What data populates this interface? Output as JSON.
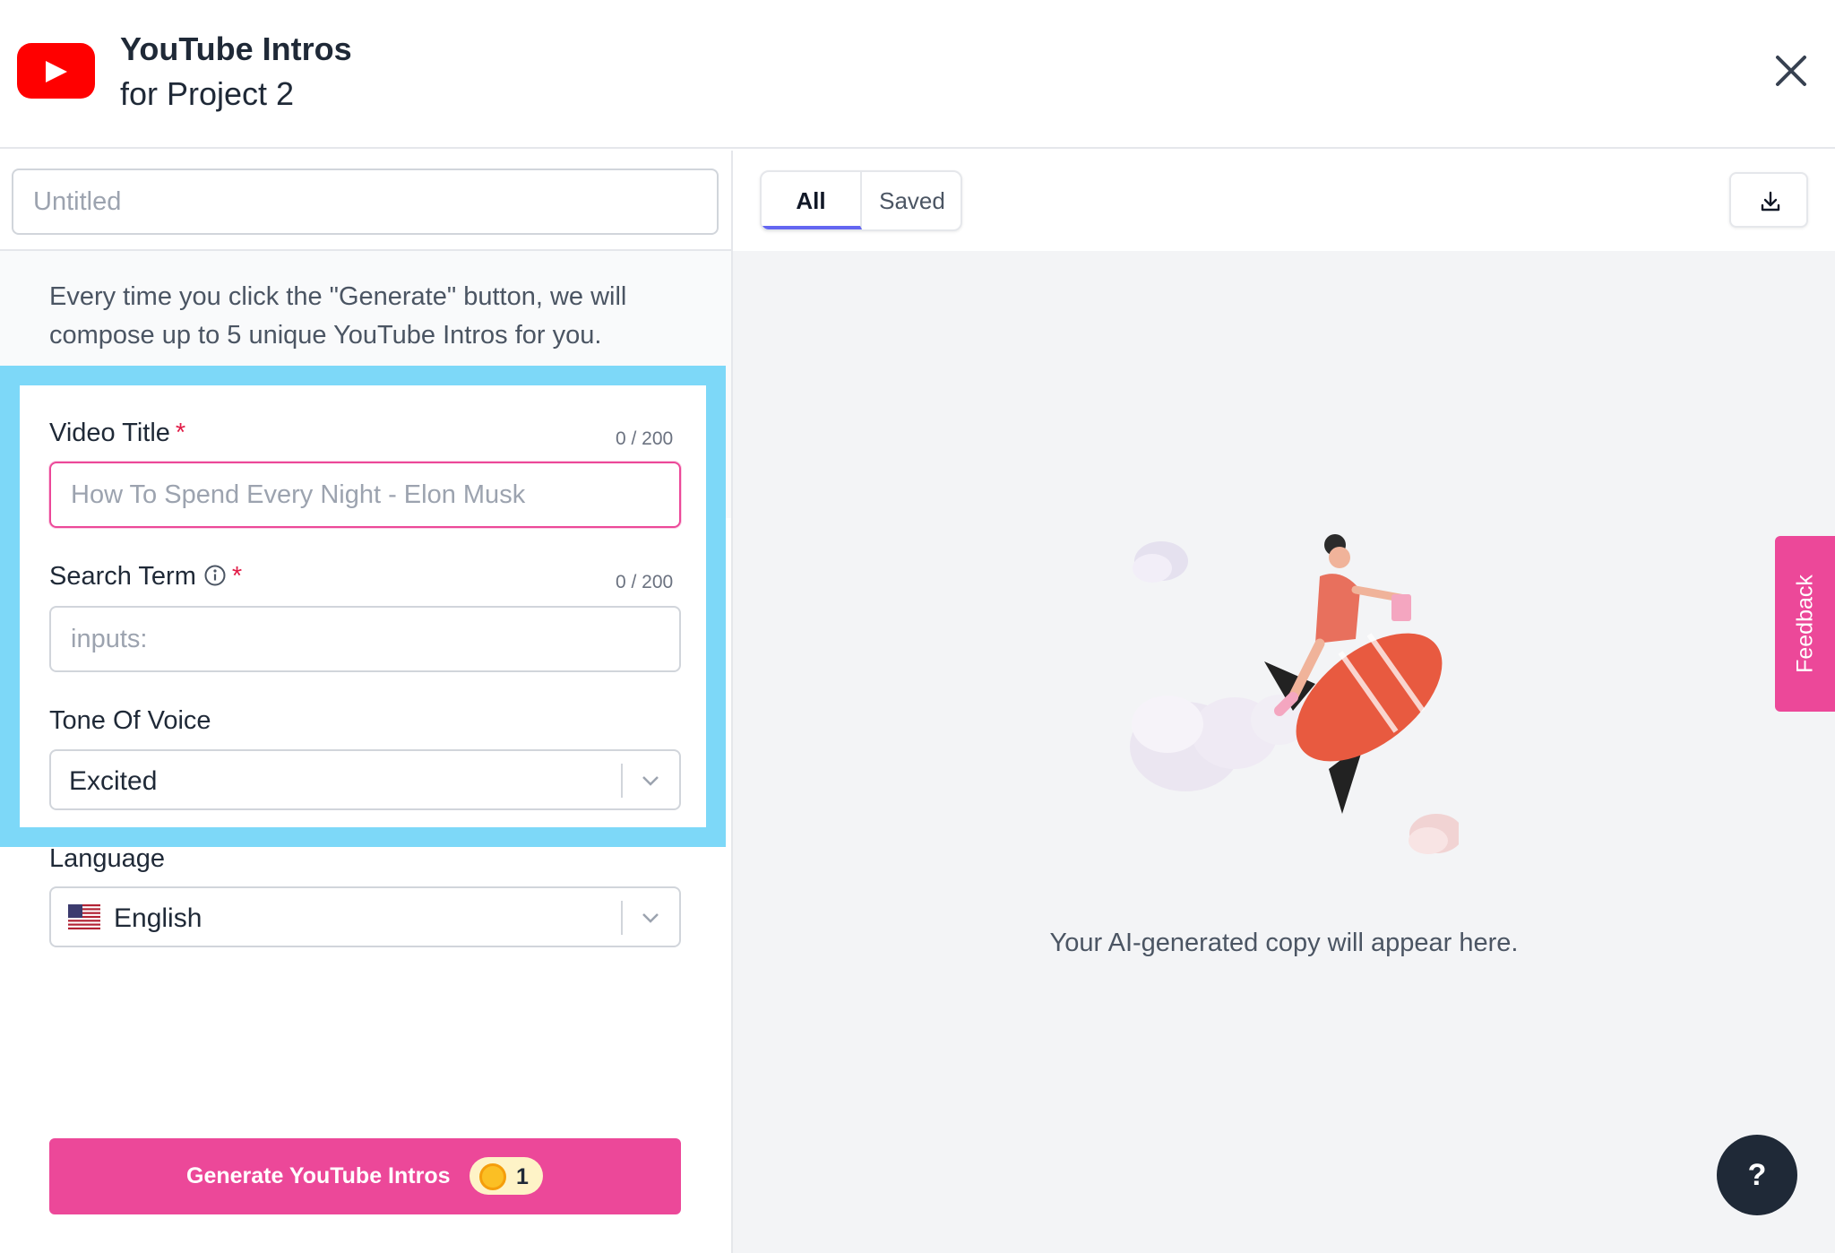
{
  "header": {
    "title": "YouTube Intros",
    "subtitle": "for Project 2",
    "logo_icon": "youtube-logo-icon",
    "close_icon": "close-icon"
  },
  "left": {
    "doc_title_placeholder": "Untitled",
    "info_text": "Every time you click the \"Generate\" button, we will compose up to 5 unique YouTube Intros for you.",
    "video_title": {
      "label": "Video Title",
      "required": "*",
      "count": "0 / 200",
      "placeholder": "How To Spend Every Night - Elon Musk"
    },
    "search_term": {
      "label": "Search Term",
      "required": "*",
      "count": "0 / 200",
      "placeholder": "inputs:"
    },
    "tone": {
      "label": "Tone Of Voice",
      "value": "Excited"
    },
    "language": {
      "label": "Language",
      "value": "English"
    },
    "generate": {
      "label": "Generate YouTube Intros",
      "credits": "1"
    }
  },
  "right": {
    "tabs": [
      "All",
      "Saved"
    ],
    "active_tab": "All",
    "empty_text": "Your AI-generated copy will appear here.",
    "feedback_label": "Feedback",
    "help_label": "?"
  },
  "colors": {
    "accent": "#ec4899",
    "highlight": "#7dd8f8",
    "youtube_red": "#ff0000",
    "tab_indicator": "#6366f1"
  }
}
